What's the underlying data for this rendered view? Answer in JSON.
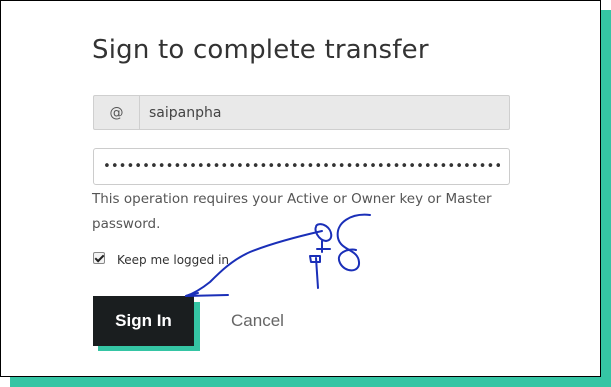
{
  "dialog": {
    "title": "Sign to complete transfer",
    "username": {
      "prefix": "@",
      "value": "saipanpha"
    },
    "password": {
      "value": "••••••••••••••••••••••••••••••••••••••••••••••••••••"
    },
    "hint": "This operation requires your Active or Owner key or Master password.",
    "keep_logged_in": {
      "label": "Keep me logged in",
      "checked": true
    },
    "buttons": {
      "sign_in": "Sign In",
      "cancel": "Cancel"
    }
  },
  "colors": {
    "accent": "#35c5a4",
    "primary_button": "#1a1e1f",
    "annotation_ink": "#1a2fb8"
  }
}
